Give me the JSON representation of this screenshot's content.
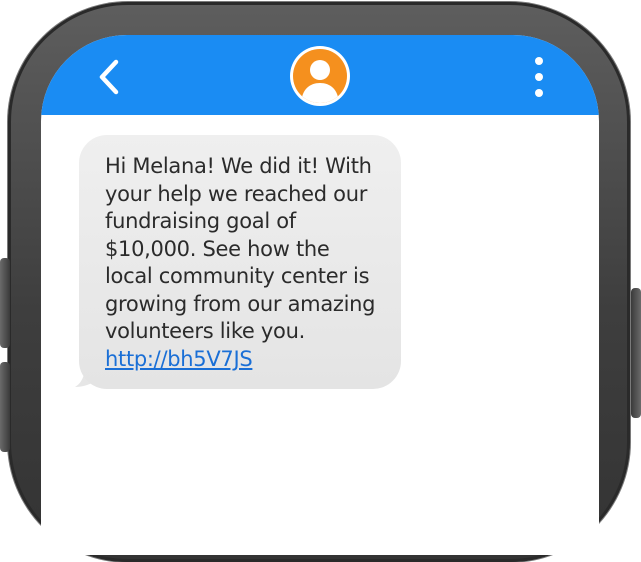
{
  "colors": {
    "header_bg": "#1a8cf3",
    "avatar_bg": "#f5901e",
    "bubble_bg": "#e8e8e8",
    "link": "#1a6fd6"
  },
  "header": {
    "back_icon": "chevron-left-icon",
    "avatar_icon": "user-silhouette-icon",
    "menu_icon": "vertical-dots-icon"
  },
  "message": {
    "lines": [
      "Hi Melana! We did it! With",
      "your help we reached our",
      "fundraising goal of",
      "$10,000. See how the",
      "local community center is",
      "growing from our amazing",
      "volunteers like you."
    ],
    "link_text": "http://bh5V7JS"
  }
}
